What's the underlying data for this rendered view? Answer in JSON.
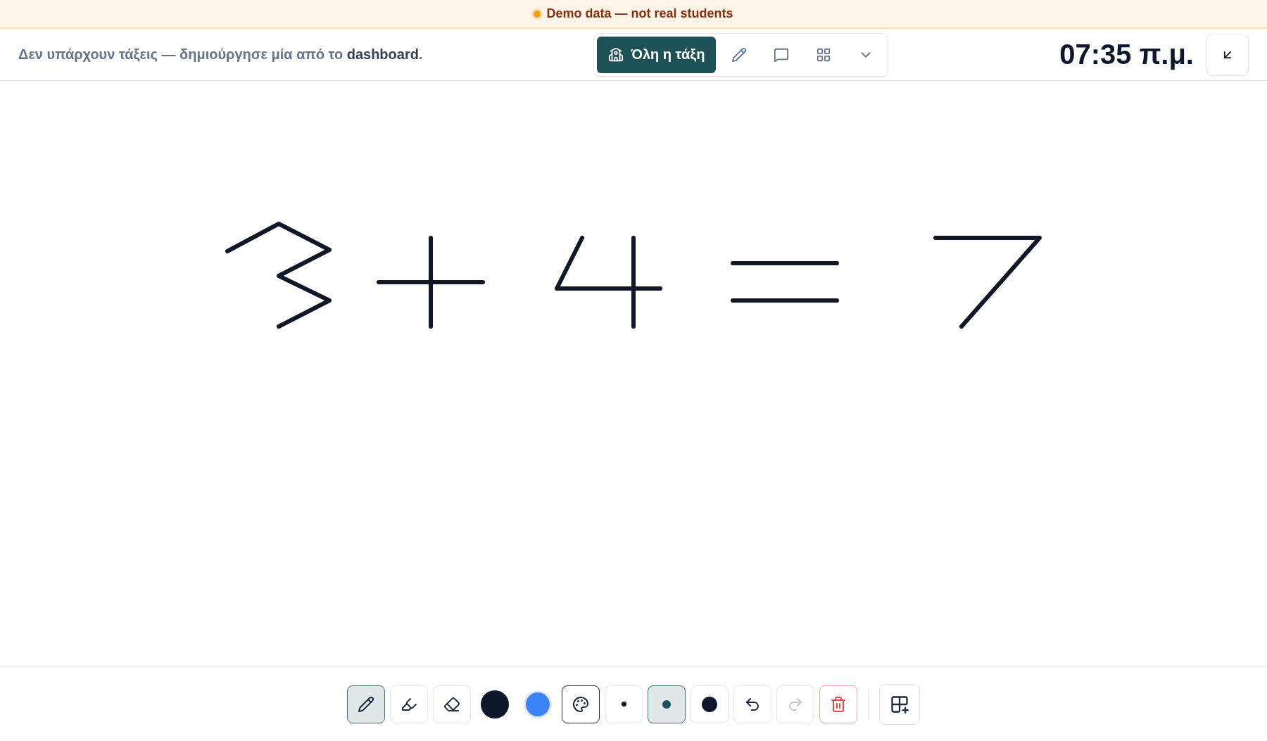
{
  "banner": {
    "text": "Demo data — not real students"
  },
  "header": {
    "notice": "Δεν υπάρχουν τάξεις — δημιούργησε μία από το **dashboard**.",
    "class_button": "Όλη η τάξη",
    "clock": "07:35 π.μ."
  },
  "tools": [
    {
      "kind": "pen",
      "selected": true
    },
    {
      "kind": "highlighter",
      "selected": false
    },
    {
      "kind": "eraser",
      "selected": false
    }
  ],
  "colors": [
    {
      "color": "#0f172a",
      "selected": true
    },
    {
      "color": "#3b82f6",
      "selected": false
    }
  ],
  "sizes": [
    {
      "kind": "small",
      "selected": false
    },
    {
      "kind": "medium",
      "selected": true
    },
    {
      "kind": "large",
      "selected": false
    }
  ],
  "redo": {
    "disabled": true
  }
}
